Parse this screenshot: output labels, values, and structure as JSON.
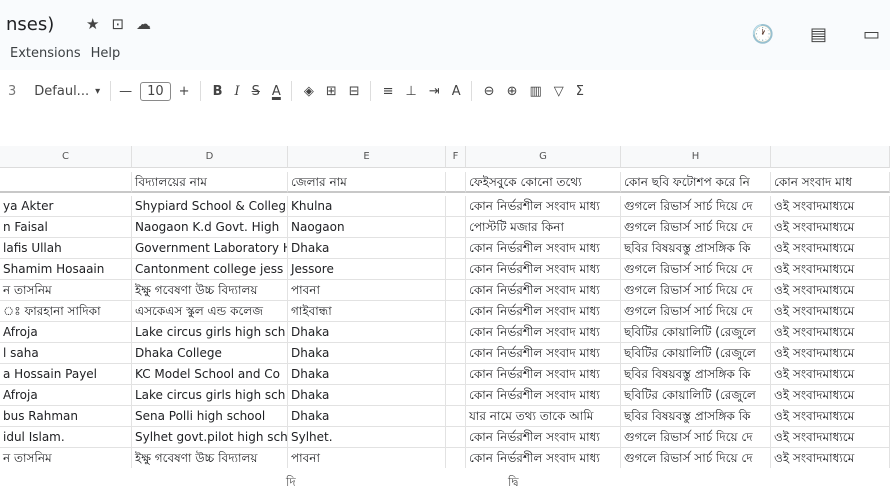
{
  "doc": {
    "title": "nses)",
    "menu": [
      "Extensions",
      "Help"
    ]
  },
  "icons": {
    "star": "★",
    "folder": "⊡",
    "cloud": "☁",
    "history": "🕐",
    "comment": "▤",
    "meet": "▭"
  },
  "toolbar": {
    "lead": "3",
    "font": "Defaul...",
    "font_arrow": "▾",
    "minus": "—",
    "font_size": "10",
    "plus": "+",
    "bold": "B",
    "italic": "I",
    "strike": "S",
    "text_color": "A",
    "fill": "◈",
    "borders": "⊞",
    "merge": "⊟",
    "align": "≡",
    "valign": "⊥",
    "wrap": "⇥",
    "rotate": "A",
    "link": "⊖",
    "comment": "⊕",
    "chart": "▥",
    "filter": "▽",
    "functions": "Σ"
  },
  "columns": [
    "C",
    "D",
    "E",
    "F",
    "G",
    "H"
  ],
  "header_row": {
    "D": "বিদ্যালয়ের নাম",
    "E": "জেলার নাম",
    "G": "ফেইসবুকে কোনো তথ্যে",
    "H": "কোন ছবি ফটোশপ করে নি",
    "I": "কোন সংবাদ মাধ"
  },
  "rows": [
    {
      "C": "ya Akter",
      "D": "Shypiard School & Colleg",
      "E": "Khulna",
      "G": "কোন নির্ভরশীল সংবাদ মাধ্য",
      "H": "গুগলে রিভার্স সার্চ দিয়ে দে",
      "I": "ওই সংবাদমাধ্যমে"
    },
    {
      "C": "n Faisal",
      "D": "Naogaon K.d Govt. High",
      "E": "Naogaon",
      "G": "পোস্টটি মজার কিনা",
      "H": "গুগলে রিভার্স সার্চ দিয়ে দে",
      "I": "ওই সংবাদমাধ্যমে"
    },
    {
      "C": "lafis Ullah",
      "D": "Government Laboratory H",
      "E": "Dhaka",
      "G": "কোন নির্ভরশীল সংবাদ মাধ্য",
      "H": "ছবির বিষয়বস্তু প্রাসঙ্গিক কি",
      "I": "ওই সংবাদমাধ্যমে"
    },
    {
      "C": "Shamim Hosaain",
      "D": "Cantonment college jess",
      "E": "Jessore",
      "G": "কোন নির্ভরশীল সংবাদ মাধ্য",
      "H": "গুগলে রিভার্স সার্চ দিয়ে দে",
      "I": "ওই সংবাদমাধ্যমে"
    },
    {
      "C": "ন তাসনিম",
      "D": "ইক্ষু গবেষণা উচ্চ বিদ্যালয়",
      "E": "পাবনা",
      "G": "কোন নির্ভরশীল সংবাদ মাধ্য",
      "H": "গুগলে রিভার্স সার্চ দিয়ে দে",
      "I": "ওই সংবাদমাধ্যমে"
    },
    {
      "C": "ঃ ফারহানা সাদিকা",
      "D": "এসকেএস স্কুল এন্ড কলেজ",
      "E": "গাইবান্ধা",
      "G": "কোন নির্ভরশীল সংবাদ মাধ্য",
      "H": "গুগলে রিভার্স সার্চ দিয়ে দে",
      "I": "ওই সংবাদমাধ্যমে"
    },
    {
      "C": "Afroja",
      "D": "Lake circus girls high sch",
      "E": "Dhaka",
      "G": "কোন নির্ভরশীল সংবাদ মাধ্য",
      "H": "ছবিটির কোয়ালিটি (রেজুলে",
      "I": "ওই সংবাদমাধ্যমে"
    },
    {
      "C": "l saha",
      "D": "Dhaka College",
      "E": "Dhaka",
      "G": "কোন নির্ভরশীল সংবাদ মাধ্য",
      "H": "ছবিটির কোয়ালিটি (রেজুলে",
      "I": "ওই সংবাদমাধ্যমে"
    },
    {
      "C": "a Hossain Payel",
      "D": "KC Model School and Co",
      "E": "Dhaka",
      "G": "কোন নির্ভরশীল সংবাদ মাধ্য",
      "H": "ছবির বিষয়বস্তু প্রাসঙ্গিক কি",
      "I": "ওই সংবাদমাধ্যমে"
    },
    {
      "C": "Afroja",
      "D": "Lake circus girls high sch",
      "E": "Dhaka",
      "G": "কোন নির্ভরশীল সংবাদ মাধ্য",
      "H": "ছবিটির কোয়ালিটি (রেজুলে",
      "I": "ওই সংবাদমাধ্যমে"
    },
    {
      "C": "bus Rahman",
      "D": "Sena Polli high school",
      "E": "Dhaka",
      "G": "যার নামে তথ্য তাকে আমি",
      "H": "ছবির বিষয়বস্তু প্রাসঙ্গিক কি",
      "I": "ওই সংবাদমাধ্যমে"
    },
    {
      "C": "idul Islam.",
      "D": "Sylhet govt.pilot high sch",
      "E": "Sylhet.",
      "G": "কোন নির্ভরশীল সংবাদ মাধ্য",
      "H": "গুগলে রিভার্স সার্চ দিয়ে দে",
      "I": "ওই সংবাদমাধ্যমে"
    },
    {
      "C": "ন তাসনিম",
      "D": "ইক্ষু গবেষণা উচ্চ বিদ্যালয়",
      "E": "পাবনা",
      "G": "কোন নির্ভরশীল সংবাদ মাধ্য",
      "H": "গুগলে রিভার্স সার্চ দিয়ে দে",
      "I": "ওই সংবাদমাধ্যমে"
    }
  ],
  "footer": {
    "left": "দি",
    "right": "দ্বি"
  }
}
